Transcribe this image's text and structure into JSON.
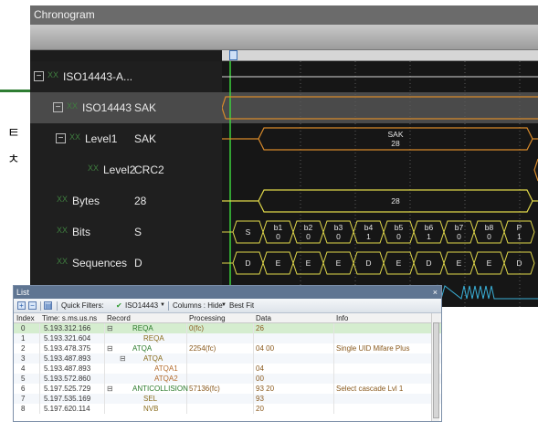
{
  "chronogram": {
    "title": "Chronogram",
    "rows": [
      {
        "name": "ISO14443-A...",
        "value": "",
        "expandable": true,
        "selected": false
      },
      {
        "name": "ISO14443",
        "value": "SAK",
        "expandable": true,
        "selected": true
      },
      {
        "name": "Level1",
        "value": "SAK",
        "expandable": true,
        "selected": false
      },
      {
        "name": "Level2",
        "value": "CRC2",
        "expandable": false,
        "selected": false
      },
      {
        "name": "Bytes",
        "value": "28",
        "expandable": false,
        "selected": false
      },
      {
        "name": "Bits",
        "value": "S",
        "expandable": false,
        "selected": false
      },
      {
        "name": "Sequences",
        "value": "D",
        "expandable": false,
        "selected": false
      }
    ],
    "level1_wave": {
      "label": "SAK",
      "value": "28"
    },
    "bytes_wave": {
      "value": "28"
    },
    "bits_wave": [
      {
        "top": "S",
        "bottom": ""
      },
      {
        "top": "b1",
        "bottom": "0"
      },
      {
        "top": "b2",
        "bottom": "0"
      },
      {
        "top": "b3",
        "bottom": "0"
      },
      {
        "top": "b4",
        "bottom": "1"
      },
      {
        "top": "b5",
        "bottom": "0"
      },
      {
        "top": "b6",
        "bottom": "1"
      },
      {
        "top": "b7",
        "bottom": "0"
      },
      {
        "top": "b8",
        "bottom": "0"
      },
      {
        "top": "P",
        "bottom": "1"
      }
    ],
    "sequence_wave": [
      "D",
      "E",
      "E",
      "E",
      "D",
      "E",
      "D",
      "E",
      "E",
      "D"
    ],
    "colors": {
      "accent_green": "#3ccf3c",
      "level1_orange": "#d88a2a",
      "bytes_yellow": "#e0d84a",
      "trace_cyan": "#3ab0d8"
    }
  },
  "list": {
    "title": "List",
    "close_glyph": "× ",
    "toolbar": {
      "quick_filters_label": "Quick Filters:",
      "filter_value": "ISO14443",
      "columns_label": "Columns : Hide",
      "best_fit_label": "Best Fit"
    },
    "columns": [
      "Index",
      "Time: s.ms.us.ns",
      "Record",
      "Processing",
      "Data",
      "Info"
    ],
    "rows": [
      {
        "index": "0",
        "time": "5.193.312.166",
        "toggle": "⊟",
        "record": "REQA",
        "indent": 0,
        "processing": "0(fc)",
        "data": "26",
        "info": ""
      },
      {
        "index": "1",
        "time": "5.193.321.604",
        "toggle": "",
        "record": "REQA",
        "indent": 1,
        "processing": "",
        "data": "",
        "info": ""
      },
      {
        "index": "2",
        "time": "5.193.478.375",
        "toggle": "⊟",
        "record": "ATQA",
        "indent": 0,
        "processing": "2254(fc)",
        "data": "04 00",
        "info": "Single UID Mifare Plus"
      },
      {
        "index": "3",
        "time": "5.193.487.893",
        "toggle": "⊟",
        "record": "ATQA",
        "indent": 1,
        "processing": "",
        "data": "",
        "info": ""
      },
      {
        "index": "4",
        "time": "5.193.487.893",
        "toggle": "",
        "record": "ATQA1",
        "indent": 2,
        "processing": "",
        "data": "04",
        "info": ""
      },
      {
        "index": "5",
        "time": "5.193.572.860",
        "toggle": "",
        "record": "ATQA2",
        "indent": 2,
        "processing": "",
        "data": "00",
        "info": ""
      },
      {
        "index": "6",
        "time": "5.197.525.729",
        "toggle": "⊟",
        "record": "ANTICOLLISION",
        "indent": 0,
        "processing": "57136(fc)",
        "data": "93 20",
        "info": "Select cascade Lvl 1"
      },
      {
        "index": "7",
        "time": "5.197.535.169",
        "toggle": "",
        "record": "SEL",
        "indent": 1,
        "processing": "",
        "data": "93",
        "info": ""
      },
      {
        "index": "8",
        "time": "5.197.620.114",
        "toggle": "",
        "record": "NVB",
        "indent": 1,
        "processing": "",
        "data": "20",
        "info": ""
      }
    ]
  }
}
